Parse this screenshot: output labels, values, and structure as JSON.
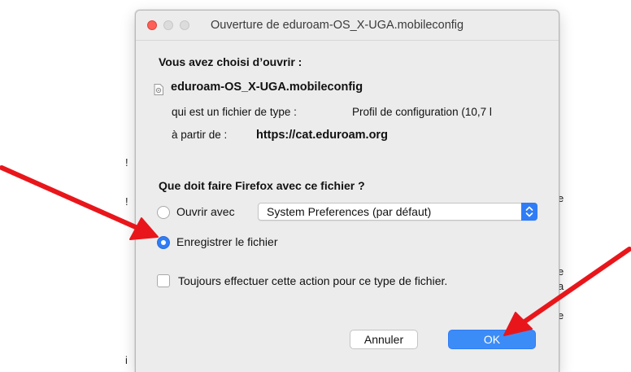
{
  "window": {
    "title": "Ouverture de eduroam-OS_X-UGA.mobileconfig"
  },
  "content": {
    "chosen_heading": "Vous avez choisi d’ouvrir :",
    "file_name": "eduroam-OS_X-UGA.mobileconfig",
    "file_type_label": "qui est un fichier de type :",
    "file_type_value": "Profil de configuration (10,7 l",
    "from_label": "à partir de :",
    "from_value": "https://cat.eduroam.org",
    "question": "Que doit faire Firefox avec ce fichier ?"
  },
  "options": {
    "open_with_label": "Ouvrir avec",
    "open_with_app": "System Preferences (par défaut)",
    "save_file_label": "Enregistrer le fichier",
    "selected": "save",
    "always_label": "Toujours effectuer cette action pour ce type de fichier.",
    "always_checked": false
  },
  "buttons": {
    "cancel": "Annuler",
    "ok": "OK"
  },
  "colors": {
    "accent": "#2f7cf6",
    "close_light": "#fe5f57",
    "annotation_arrow": "#e8161b"
  },
  "icons": {
    "file": "config-file-icon",
    "select_arrows": "up-down-chevron-icon"
  }
}
